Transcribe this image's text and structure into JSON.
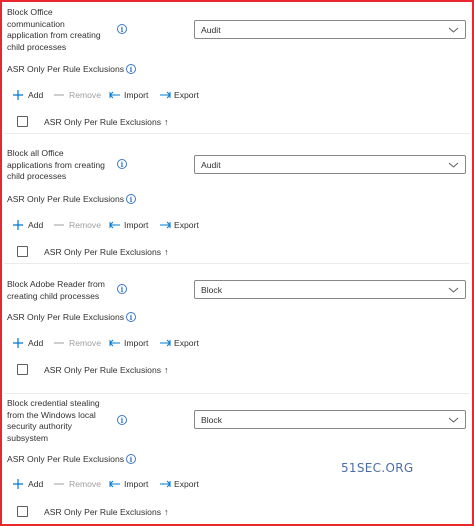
{
  "rules": [
    {
      "name_lines": [
        "Block Office",
        "communication",
        "application from creating",
        "child processes"
      ],
      "mode": "Audit",
      "exclusions_label": "ASR Only Per Rule Exclusions",
      "toolbar": {
        "add": "Add",
        "remove": "Remove",
        "import": "Import",
        "export": "Export"
      },
      "column_header": "ASR Only Per Rule Exclusions"
    },
    {
      "name_lines": [
        "Block all Office",
        "applications from creating",
        "child processes"
      ],
      "mode": "Audit",
      "exclusions_label": "ASR Only Per Rule Exclusions",
      "toolbar": {
        "add": "Add",
        "remove": "Remove",
        "import": "Import",
        "export": "Export"
      },
      "column_header": "ASR Only Per Rule Exclusions"
    },
    {
      "name_lines": [
        "Block Adobe Reader from",
        "creating child processes"
      ],
      "mode": "Block",
      "exclusions_label": "ASR Only Per Rule Exclusions",
      "toolbar": {
        "add": "Add",
        "remove": "Remove",
        "import": "Import",
        "export": "Export"
      },
      "column_header": "ASR Only Per Rule Exclusions"
    },
    {
      "name_lines": [
        "Block credential stealing",
        "from the Windows local",
        "security authority",
        "subsystem"
      ],
      "mode": "Block",
      "exclusions_label": "ASR Only Per Rule Exclusions",
      "toolbar": {
        "add": "Add",
        "remove": "Remove",
        "import": "Import",
        "export": "Export"
      },
      "column_header": "ASR Only Per Rule Exclusions"
    }
  ],
  "sort_glyph": "↑",
  "watermark": "51SEC.ORG",
  "colors": {
    "frame": "#e8272e",
    "accent": "#0078d4",
    "disabled": "#a19f9d",
    "text": "#323130"
  }
}
